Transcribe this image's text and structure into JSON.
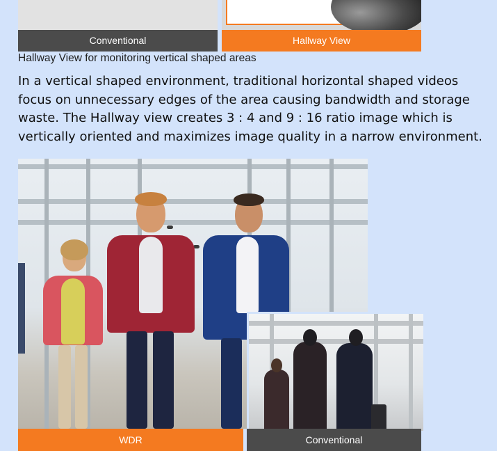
{
  "top_panels": {
    "left_label": "Conventional",
    "right_label": "Hallway View"
  },
  "caption": "Hallway View for monitoring vertical shaped areas",
  "description": "In a vertical shaped environment, traditional horizontal shaped videos focus on unnecessary edges of the area causing bandwidth and storage waste. The Hallway view creates 3 : 4 and 9 : 16 ratio image which is vertically oriented and maximizes image quality in a narrow environment.",
  "bottom_panels": {
    "left_label": "WDR",
    "right_label": "Conventional"
  },
  "colors": {
    "background": "#d3e3fb",
    "accent_orange": "#f47a20",
    "label_gray": "#4b4b4b"
  }
}
